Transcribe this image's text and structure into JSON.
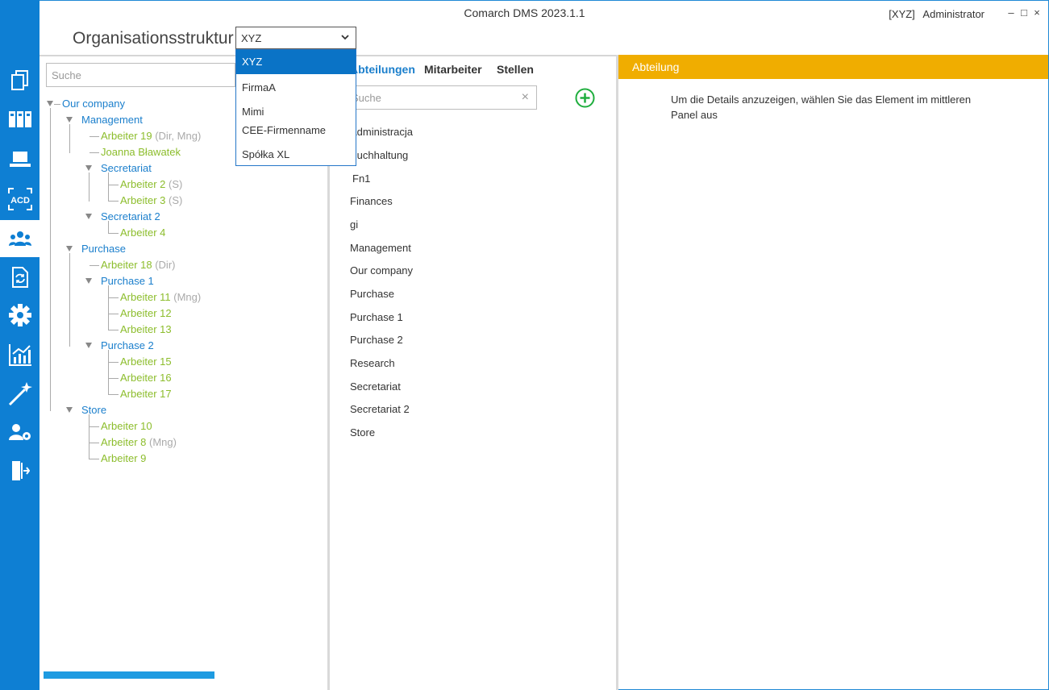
{
  "app": {
    "title": "Comarch DMS 2023.1.1",
    "company_tag": "[XYZ]",
    "user": "Administrator"
  },
  "window_controls": {
    "minimize": "–",
    "maximize": "□",
    "close": "×"
  },
  "nav": {
    "items": [
      {
        "icon": "documents-icon"
      },
      {
        "icon": "columns-icon"
      },
      {
        "icon": "laptop-icon"
      },
      {
        "icon": "acd-icon",
        "label": "ACD"
      },
      {
        "icon": "people-icon",
        "active": true
      },
      {
        "icon": "document-sync-icon"
      },
      {
        "icon": "gear-icon"
      },
      {
        "icon": "chart-icon"
      },
      {
        "icon": "magic-wand-icon"
      },
      {
        "icon": "user-settings-icon"
      },
      {
        "icon": "logout-icon"
      }
    ]
  },
  "header": {
    "title": "Organisationsstruktur",
    "company_select": {
      "value": "XYZ",
      "options": [
        "XYZ",
        "FirmaA",
        "Mimi",
        "CEE-Firmenname",
        "Spółka XL"
      ],
      "selected": "XYZ"
    }
  },
  "left_panel": {
    "search_placeholder": "Suche",
    "tree": {
      "our_company": "Our company",
      "management": "Management",
      "arbeiter19": "Arbeiter 19",
      "arbeiter19_suffix": "(Dir, Mng)",
      "joanna": "Joanna Bławatek",
      "secretariat": "Secretariat",
      "arbeiter2": "Arbeiter 2",
      "arbeiter2_suffix": "(S)",
      "arbeiter3": "Arbeiter 3",
      "arbeiter3_suffix": "(S)",
      "secretariat2": "Secretariat 2",
      "arbeiter4": "Arbeiter 4",
      "purchase": "Purchase",
      "arbeiter18": "Arbeiter 18",
      "arbeiter18_suffix": "(Dir)",
      "purchase1": "Purchase 1",
      "arbeiter11": "Arbeiter 11",
      "arbeiter11_suffix": "(Mng)",
      "arbeiter12": "Arbeiter 12",
      "arbeiter13": "Arbeiter 13",
      "purchase2": "Purchase 2",
      "arbeiter15": "Arbeiter 15",
      "arbeiter16": "Arbeiter 16",
      "arbeiter17": "Arbeiter 17",
      "store": "Store",
      "arbeiter10": "Arbeiter 10",
      "arbeiter8": "Arbeiter 8",
      "arbeiter8_suffix": "(Mng)",
      "arbeiter9": "Arbeiter 9"
    }
  },
  "mid_panel": {
    "tabs": [
      "Abteilungen",
      "Mitarbeiter",
      "Stellen"
    ],
    "active_tab": "Abteilungen",
    "search_placeholder": "Suche",
    "search_clear": "×",
    "departments": [
      "Administracja",
      "Buchhaltung",
      "Fn1",
      "Finances",
      "gi",
      "Management",
      "Our company",
      "Purchase",
      "Purchase 1",
      "Purchase 2",
      "Research",
      "Secretariat",
      "Secretariat 2",
      "Store"
    ]
  },
  "right_panel": {
    "header": "Abteilung",
    "info": "Um die Details anzuzeigen, wählen Sie das Element im mittleren Panel aus"
  },
  "colors": {
    "nav_blue": "#0e7fd3",
    "dept_blue": "#1b7fcc",
    "employee_green": "#8cbd2c",
    "header_orange": "#f0ad00",
    "dropdown_selected": "#0a73c6",
    "add_green": "#1fae3e"
  }
}
